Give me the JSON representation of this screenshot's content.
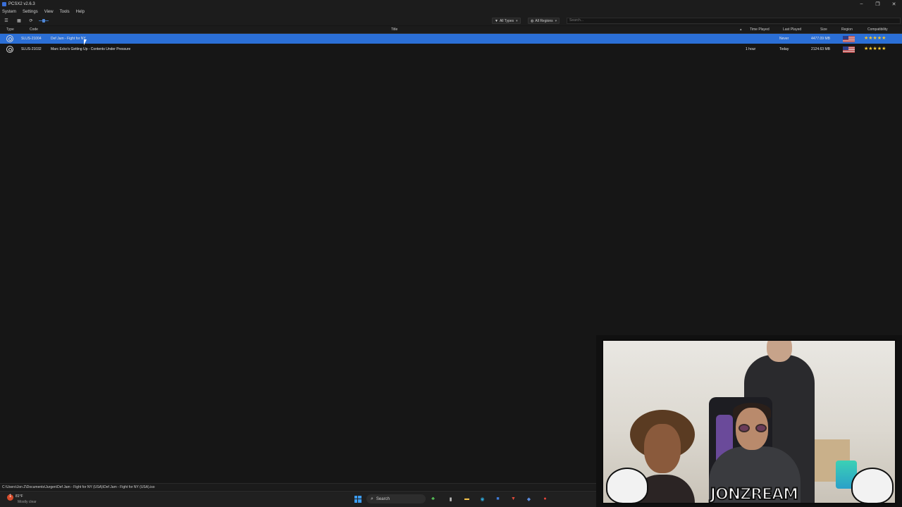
{
  "window": {
    "title": "PCSX2 v2.6.3",
    "controls": [
      "–",
      "❐",
      "✕"
    ]
  },
  "menu": [
    "System",
    "Settings",
    "View",
    "Tools",
    "Help"
  ],
  "toolbar": {
    "filters": [
      {
        "label": "All Types",
        "icon": "filter-icon"
      },
      {
        "label": "All Regions",
        "icon": "globe-icon"
      }
    ],
    "search_placeholder": "Search..."
  },
  "columns": {
    "type": "Type",
    "code": "Code",
    "title": "Title",
    "time_played": "Time Played",
    "last_played": "Last Played",
    "size": "Size",
    "region": "Region",
    "compatibility": "Compatibility"
  },
  "games": [
    {
      "code": "SLUS-21004",
      "title": "Def Jam - Fight for NY",
      "time_played": "",
      "last_played": "Never",
      "size": "4477.09 MB",
      "region_flag": "us-flag",
      "stars": "★★★★★",
      "rating": 5,
      "selected": true
    },
    {
      "code": "SLUS-21032",
      "title": "Marc Ecko's Getting Up - Contents Under Pressure",
      "time_played": "1 hour",
      "last_played": "Today",
      "size": "2124.63 MB",
      "region_flag": "us-flag",
      "stars": "★★★★★",
      "rating": 5,
      "selected": false
    }
  ],
  "statusbar": {
    "path": "C:\\Users\\Jon Z\\Documents\\Jurgen\\Def Jam - Fight for NY (USA)\\Def Jam - Fight for NY (USA).iso"
  },
  "taskbar": {
    "weather_temp": "81°F",
    "weather_cond": "Mostly clear",
    "search_label": "Search"
  },
  "overlay": {
    "brand": "JONZREAM"
  },
  "colors": {
    "selection": "#2b6fd6",
    "stars": "#f2c531",
    "background": "#161616"
  }
}
